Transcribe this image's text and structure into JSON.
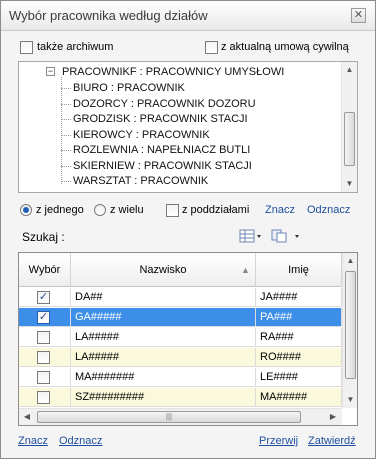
{
  "window": {
    "title": "Wybór pracownika według działów"
  },
  "options": {
    "archive_label": "także archiwum",
    "civil_contract_label": "z aktualną umową cywilną"
  },
  "tree": {
    "root": "PRACOWNIKF : PRACOWNICY UMYSŁOWI",
    "children": [
      "BIURO : PRACOWNIK",
      "DOZORCY : PRACOWNIK DOZORU",
      "GRODZISK : PRACOWNIK STACJI",
      "KIEROWCY : PRACOWNIK",
      "ROZLEWNIA : NAPEŁNIACZ BUTLI",
      "SKIERNIEW : PRACOWNIK STACJI",
      "WARSZTAT : PRACOWNIK"
    ]
  },
  "selection_mode": {
    "single_label": "z jednego",
    "multi_label": "z wielu",
    "subdepartments_label": "z poddziałami",
    "mark_link": "Znacz",
    "unmark_link": "Odznacz"
  },
  "search": {
    "label": "Szukaj :",
    "value": ""
  },
  "grid": {
    "columns": [
      "Wybór",
      "Nazwisko",
      "Imię"
    ],
    "rows": [
      {
        "checked": true,
        "surname": "DA##",
        "name": "JA####",
        "selected": false,
        "alt": false
      },
      {
        "checked": true,
        "surname": "GA#####",
        "name": "PA###",
        "selected": true,
        "alt": false
      },
      {
        "checked": false,
        "surname": "LA#####",
        "name": "RA###",
        "selected": false,
        "alt": false
      },
      {
        "checked": false,
        "surname": "LA#####",
        "name": "RO####",
        "selected": false,
        "alt": true
      },
      {
        "checked": false,
        "surname": "MA#######",
        "name": "LE####",
        "selected": false,
        "alt": false
      },
      {
        "checked": false,
        "surname": "SZ#########",
        "name": "MA#####",
        "selected": false,
        "alt": true
      }
    ]
  },
  "footer": {
    "mark_link": "Znacz",
    "unmark_link": "Odznacz",
    "cancel_link": "Przerwij",
    "confirm_link": "Zatwierdź"
  },
  "colors": {
    "accent": "#3d8ee8",
    "link": "#1f4fa0",
    "row_alt": "#fbf9dc"
  }
}
